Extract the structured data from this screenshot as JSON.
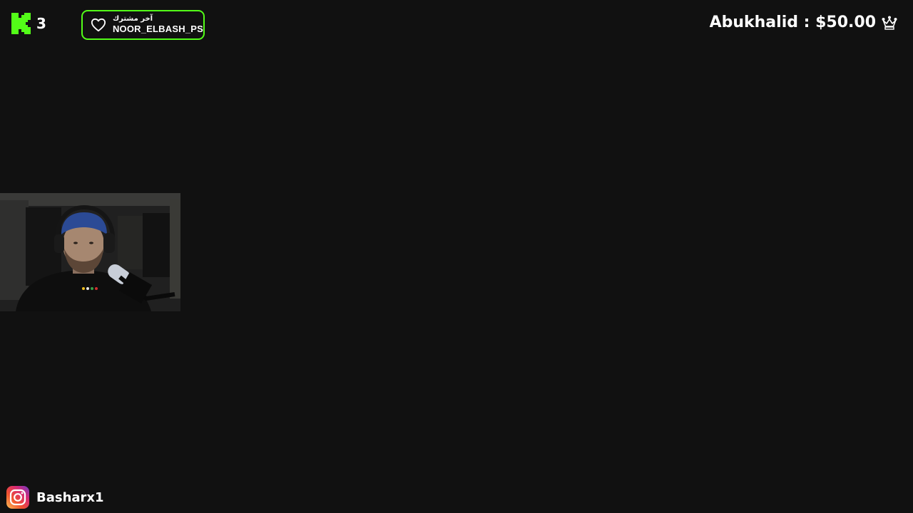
{
  "overlay": {
    "kick_badge": {
      "icon": "kick-logo-icon",
      "count": "3",
      "color": "#53fc18"
    },
    "latest_subscriber": {
      "icon": "heart-icon",
      "label": "آخر مشترك",
      "name": "NOOR_ELBASH_PS",
      "border_color": "#53fc18"
    },
    "top_donation": {
      "text": "Abukhalid : $50.00",
      "icon": "crown-icon"
    },
    "webcam": {
      "description_icon": "webcam-feed"
    },
    "social": {
      "icon": "instagram-icon",
      "handle": "Basharx1"
    }
  }
}
